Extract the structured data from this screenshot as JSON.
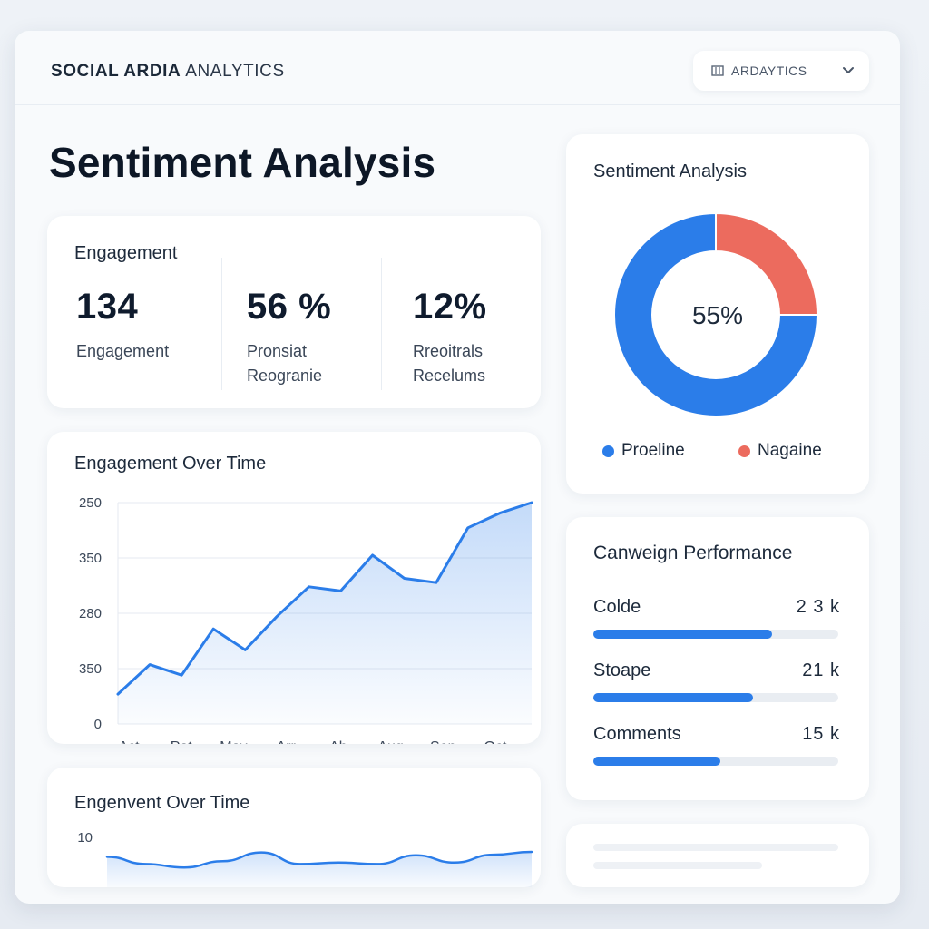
{
  "header": {
    "brand_bold": "SOCIAL ARDIA",
    "brand_thin": " ANALYTICS",
    "dropdown_label": "ARDAYTICS"
  },
  "page": {
    "title": "Sentiment Analysis"
  },
  "engagement": {
    "title": "Engagement",
    "stats": [
      {
        "value": "134",
        "line1": "Engagement",
        "line2": ""
      },
      {
        "value": "56 %",
        "line1": "Pronsiat",
        "line2": "Reogranie"
      },
      {
        "value": "12%",
        "line1": "Rreoitrals",
        "line2": "Recelums"
      }
    ]
  },
  "sentiment": {
    "title": "Sentiment Analysis",
    "center_label": "55%",
    "legend": [
      {
        "label": "Proeline",
        "color": "#2b7de9"
      },
      {
        "label": "Nagaine",
        "color": "#ec6b5e"
      }
    ],
    "slices": [
      {
        "label": "Proeline",
        "value": 75,
        "color": "#2b7de9"
      },
      {
        "label": "Nagaine",
        "value": 25,
        "color": "#ec6b5e"
      }
    ]
  },
  "campaign": {
    "title": "Canweign Performance",
    "rows": [
      {
        "name": "Colde",
        "value": "2 3 k",
        "fraction": 0.73
      },
      {
        "name": "Stoape",
        "value": "21 k",
        "fraction": 0.65
      },
      {
        "name": "Comments",
        "value": "15 k",
        "fraction": 0.52
      }
    ]
  },
  "chart_data": [
    {
      "type": "area",
      "title": "Engagement Over Time",
      "categories": [
        "Act",
        "Pat",
        "May",
        "Arr",
        "Ab",
        "Aug",
        "Sep",
        "Oct"
      ],
      "y_tick_labels": [
        "250",
        "350",
        "280",
        "350",
        "0"
      ],
      "series": [
        {
          "values": [
            0.09,
            0.23,
            0.18,
            0.4,
            0.3,
            0.46,
            0.6,
            0.58,
            0.75,
            0.64,
            0.62,
            0.88,
            0.95,
            1.0
          ]
        }
      ],
      "grid": true,
      "color": "#2b7de9"
    },
    {
      "type": "area",
      "title": "Engenvent Over Time",
      "y_tick_labels": [
        "10"
      ],
      "series": [
        {
          "values": [
            0.55,
            0.3,
            0.18,
            0.4,
            0.7,
            0.3,
            0.35,
            0.3,
            0.6,
            0.35,
            0.62,
            0.72
          ]
        }
      ],
      "color": "#2b7de9"
    }
  ]
}
